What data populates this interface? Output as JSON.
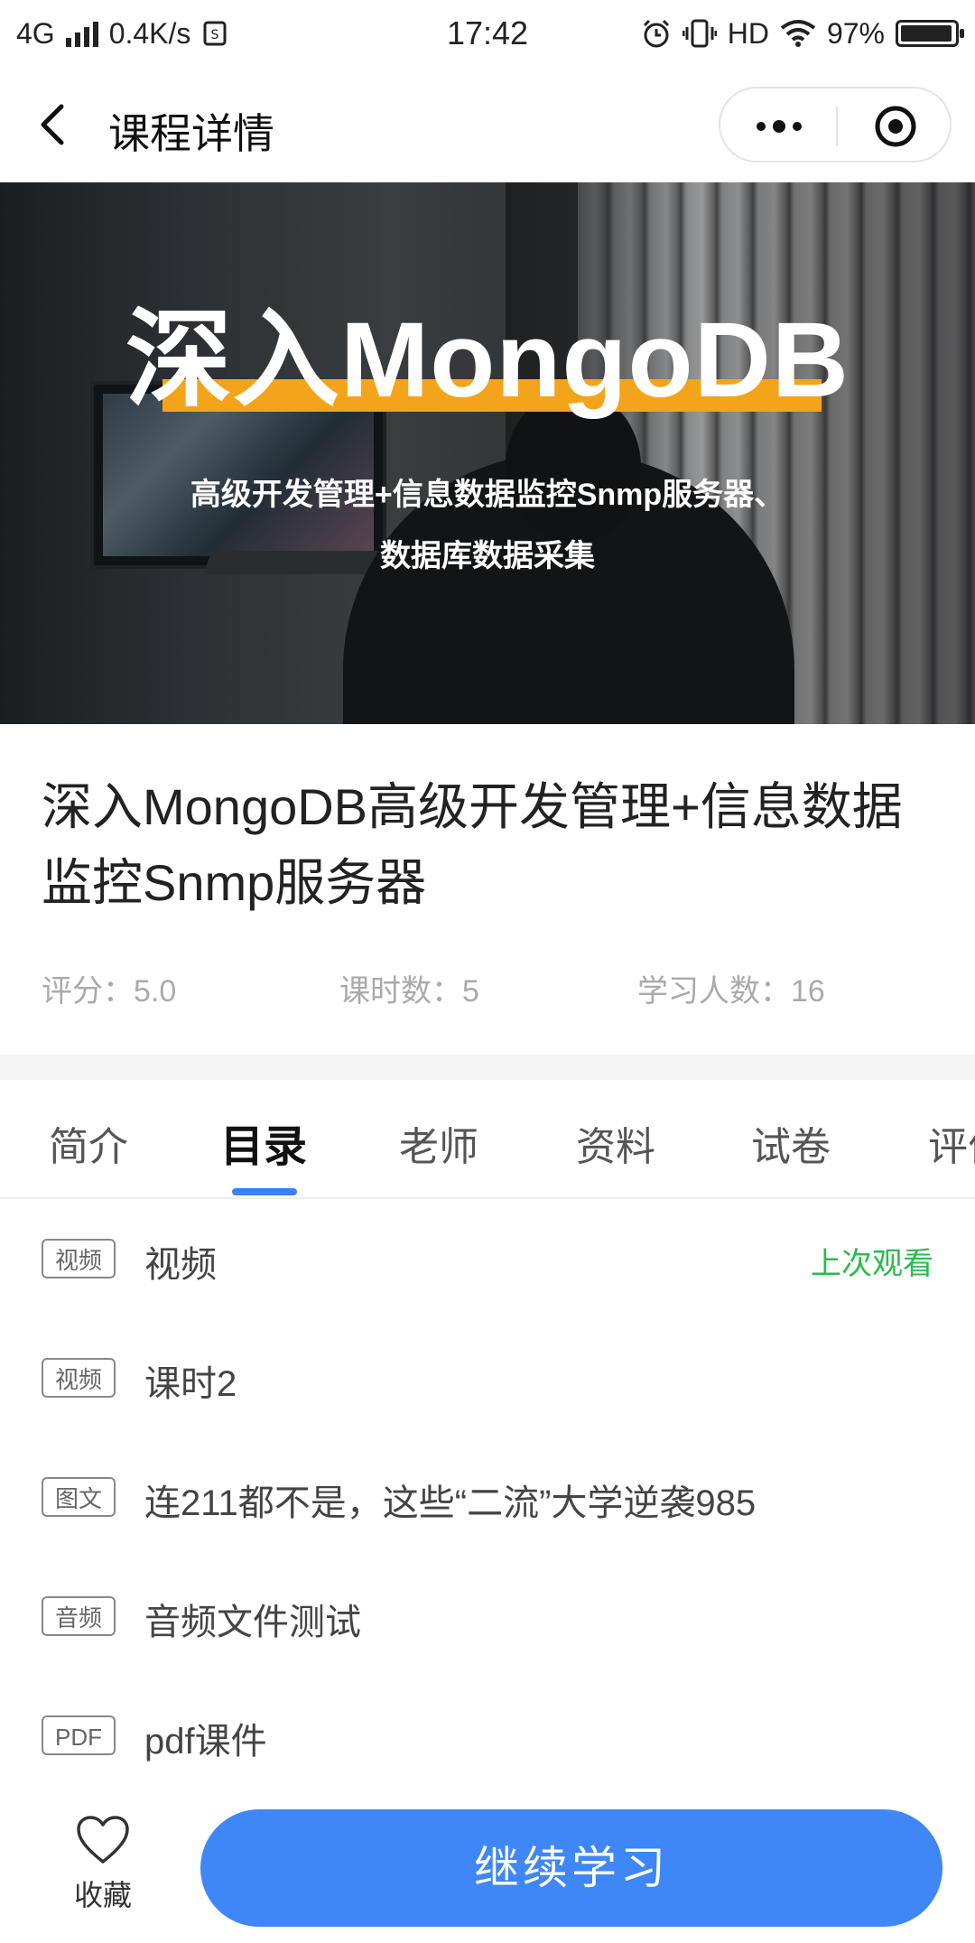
{
  "status_bar": {
    "network": "4G",
    "speed": "0.4K/s",
    "time": "17:42",
    "hd": "HD",
    "battery": "97%",
    "battery_level": 0.97
  },
  "navbar": {
    "title": "课程详情"
  },
  "banner": {
    "title": "深入MongoDB",
    "subtitle_line1": "高级开发管理+信息数据监控Snmp服务器、",
    "subtitle_line2": "数据库数据采集",
    "accent_color": "#f4a41a"
  },
  "course": {
    "title": "深入MongoDB高级开发管理+信息数据监控Snmp服务器",
    "stats": [
      {
        "text": "评分：5.0"
      },
      {
        "text": "课时数：5"
      },
      {
        "text": "学习人数：16"
      }
    ]
  },
  "tabs": [
    {
      "label": "简介"
    },
    {
      "label": "目录",
      "active": true
    },
    {
      "label": "老师"
    },
    {
      "label": "资料"
    },
    {
      "label": "试卷"
    },
    {
      "label": "评价"
    }
  ],
  "lessons": [
    {
      "type": "视频",
      "title": "视频",
      "status": "上次观看"
    },
    {
      "type": "视频",
      "title": "课时2"
    },
    {
      "type": "图文",
      "title": "连211都不是，这些“二流”大学逆袭985"
    },
    {
      "type": "音频",
      "title": "音频文件测试"
    },
    {
      "type": "PDF",
      "title": "pdf课件"
    }
  ],
  "bottom_bar": {
    "favorite_label": "收藏",
    "continue_label": "继续学习",
    "primary_color": "#3f86f7"
  }
}
